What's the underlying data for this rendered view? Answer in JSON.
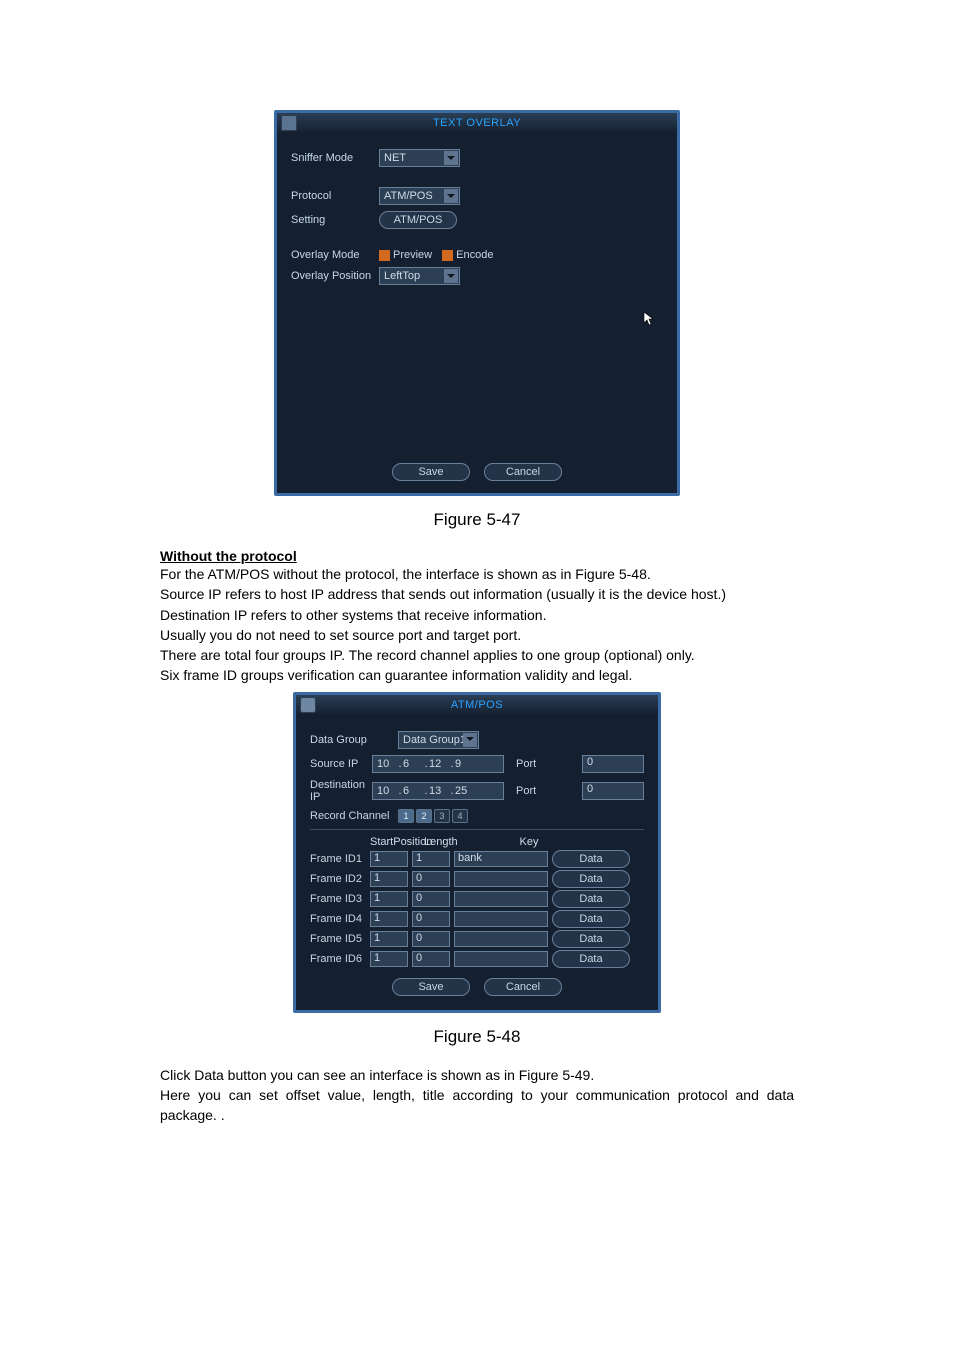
{
  "ui1": {
    "title": "TEXT OVERLAY",
    "sniffer_mode_label": "Sniffer Mode",
    "sniffer_mode_value": "NET",
    "protocol_label": "Protocol",
    "protocol_value": "ATM/POS",
    "setting_label": "Setting",
    "setting_button": "ATM/POS",
    "overlay_mode_label": "Overlay Mode",
    "preview_label": "Preview",
    "encode_label": "Encode",
    "overlay_position_label": "Overlay Position",
    "overlay_position_value": "LeftTop",
    "save": "Save",
    "cancel": "Cancel"
  },
  "caption1": "Figure 5-47",
  "doc": {
    "heading": "Without the protocol",
    "p1": "For the ATM/POS without the protocol, the interface is shown as in Figure 5-48.",
    "p2": "Source IP refers to host IP address that sends out information (usually it is the device host.)",
    "p3": "Destination IP refers to other systems that receive information.",
    "p4": "Usually you do not need to set source port and target port.",
    "p5": "There are total four groups IP. The record channel applies to one group (optional) only.",
    "p6": "Six frame ID groups verification can guarantee information validity and legal."
  },
  "ui2": {
    "title": "ATM/POS",
    "data_group_label": "Data Group",
    "data_group_value": "Data Group1",
    "source_ip_label": "Source IP",
    "source_ip": {
      "o1": "10",
      "o2": "6",
      "o3": "12",
      "o4": "9"
    },
    "source_port": "0",
    "destination_ip_label": "Destination IP",
    "dest_ip": {
      "o1": "10",
      "o2": "6",
      "o3": "13",
      "o4": "25"
    },
    "dest_port": "0",
    "port_label": "Port",
    "record_channel_label": "Record Channel",
    "channels": [
      "1",
      "2",
      "3",
      "4"
    ],
    "headers": {
      "start": "StartPosition",
      "length": "Length",
      "key": "Key"
    },
    "rows": [
      {
        "label": "Frame ID1",
        "start": "1",
        "len": "1",
        "key": "bank"
      },
      {
        "label": "Frame ID2",
        "start": "1",
        "len": "0",
        "key": ""
      },
      {
        "label": "Frame ID3",
        "start": "1",
        "len": "0",
        "key": ""
      },
      {
        "label": "Frame ID4",
        "start": "1",
        "len": "0",
        "key": ""
      },
      {
        "label": "Frame ID5",
        "start": "1",
        "len": "0",
        "key": ""
      },
      {
        "label": "Frame ID6",
        "start": "1",
        "len": "0",
        "key": ""
      }
    ],
    "data_button": "Data",
    "save": "Save",
    "cancel": "Cancel"
  },
  "caption2": "Figure 5-48",
  "doc2": {
    "p1": "Click Data button you can see an interface is shown as in Figure 5-49.",
    "p2": "Here you can set offset value, length, title according to your communication protocol and data package. ."
  }
}
